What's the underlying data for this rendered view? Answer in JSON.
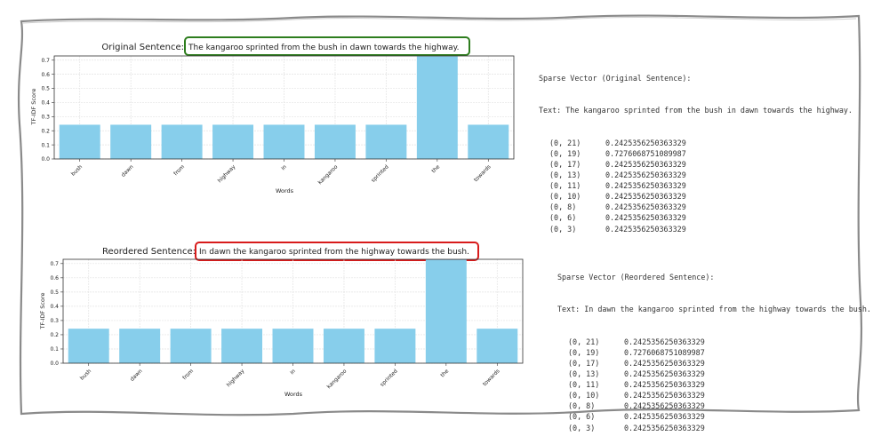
{
  "chart_data": [
    {
      "type": "bar",
      "title_prefix": "Original Sentence:",
      "title_sentence": "The kangaroo sprinted from the bush in dawn towards the highway.",
      "categories": [
        "bush",
        "dawn",
        "from",
        "highway",
        "in",
        "kangaroo",
        "sprinted",
        "the",
        "towards"
      ],
      "values": [
        0.2425,
        0.2425,
        0.2425,
        0.2425,
        0.2425,
        0.2425,
        0.2425,
        0.7276,
        0.2425
      ],
      "xlabel": "Words",
      "ylabel": "TF-IDF Score",
      "ylim": [
        0,
        0.73
      ],
      "yticks": [
        "0.0",
        "0.1",
        "0.2",
        "0.3",
        "0.4",
        "0.5",
        "0.6",
        "0.7"
      ],
      "grid": true,
      "bar_color": "#87ceeb",
      "highlight_color": "#2e7d1e"
    },
    {
      "type": "bar",
      "title_prefix": "Reordered Sentence:",
      "title_sentence": "In dawn the kangaroo sprinted from the highway towards the bush.",
      "categories": [
        "bush",
        "dawn",
        "from",
        "highway",
        "in",
        "kangaroo",
        "sprinted",
        "the",
        "towards"
      ],
      "values": [
        0.2425,
        0.2425,
        0.2425,
        0.2425,
        0.2425,
        0.2425,
        0.2425,
        0.7276,
        0.2425
      ],
      "xlabel": "Words",
      "ylabel": "TF-IDF Score",
      "ylim": [
        0,
        0.73
      ],
      "yticks": [
        "0.0",
        "0.1",
        "0.2",
        "0.3",
        "0.4",
        "0.5",
        "0.6",
        "0.7"
      ],
      "grid": true,
      "bar_color": "#87ceeb",
      "highlight_color": "#d81b1b"
    }
  ],
  "sparse": [
    {
      "heading": "Sparse Vector (Original Sentence):",
      "text_line": "Text: The kangaroo sprinted from the bush in dawn towards the highway.",
      "rows": [
        {
          "idx": "(0, 21)",
          "val": "0.2425356250363329"
        },
        {
          "idx": "(0, 19)",
          "val": "0.7276068751089987"
        },
        {
          "idx": "(0, 17)",
          "val": "0.2425356250363329"
        },
        {
          "idx": "(0, 13)",
          "val": "0.2425356250363329"
        },
        {
          "idx": "(0, 11)",
          "val": "0.2425356250363329"
        },
        {
          "idx": "(0, 10)",
          "val": "0.2425356250363329"
        },
        {
          "idx": "(0, 8)",
          "val": "0.2425356250363329"
        },
        {
          "idx": "(0, 6)",
          "val": "0.2425356250363329"
        },
        {
          "idx": "(0, 3)",
          "val": "0.2425356250363329"
        }
      ]
    },
    {
      "heading": "Sparse Vector (Reordered Sentence):",
      "text_line": "Text: In dawn the kangaroo sprinted from the highway towards the bush.",
      "rows": [
        {
          "idx": "(0, 21)",
          "val": "0.2425356250363329"
        },
        {
          "idx": "(0, 19)",
          "val": "0.7276068751089987"
        },
        {
          "idx": "(0, 17)",
          "val": "0.2425356250363329"
        },
        {
          "idx": "(0, 13)",
          "val": "0.2425356250363329"
        },
        {
          "idx": "(0, 11)",
          "val": "0.2425356250363329"
        },
        {
          "idx": "(0, 10)",
          "val": "0.2425356250363329"
        },
        {
          "idx": "(0, 8)",
          "val": "0.2425356250363329"
        },
        {
          "idx": "(0, 6)",
          "val": "0.2425356250363329"
        },
        {
          "idx": "(0, 3)",
          "val": "0.2425356250363329"
        }
      ]
    }
  ]
}
